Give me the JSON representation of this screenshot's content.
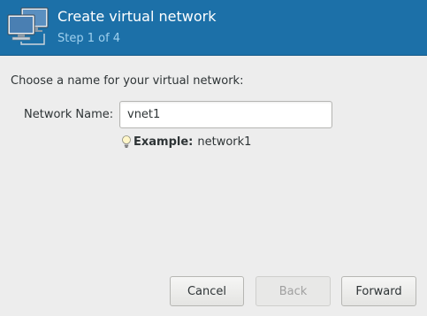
{
  "header": {
    "title": "Create virtual network",
    "step": "Step 1 of 4",
    "icon": "network-computers-icon"
  },
  "main": {
    "prompt": "Choose a name for your virtual network:",
    "network_name": {
      "label": "Network Name:",
      "value": "vnet1"
    },
    "example": {
      "icon": "lightbulb-icon",
      "label": "Example:",
      "value": "network1"
    }
  },
  "buttons": {
    "cancel": "Cancel",
    "back": "Back",
    "forward": "Forward"
  },
  "colors": {
    "header_bg": "#1c70a8",
    "step_text": "#9fd0ee",
    "window_bg": "#ededed"
  }
}
